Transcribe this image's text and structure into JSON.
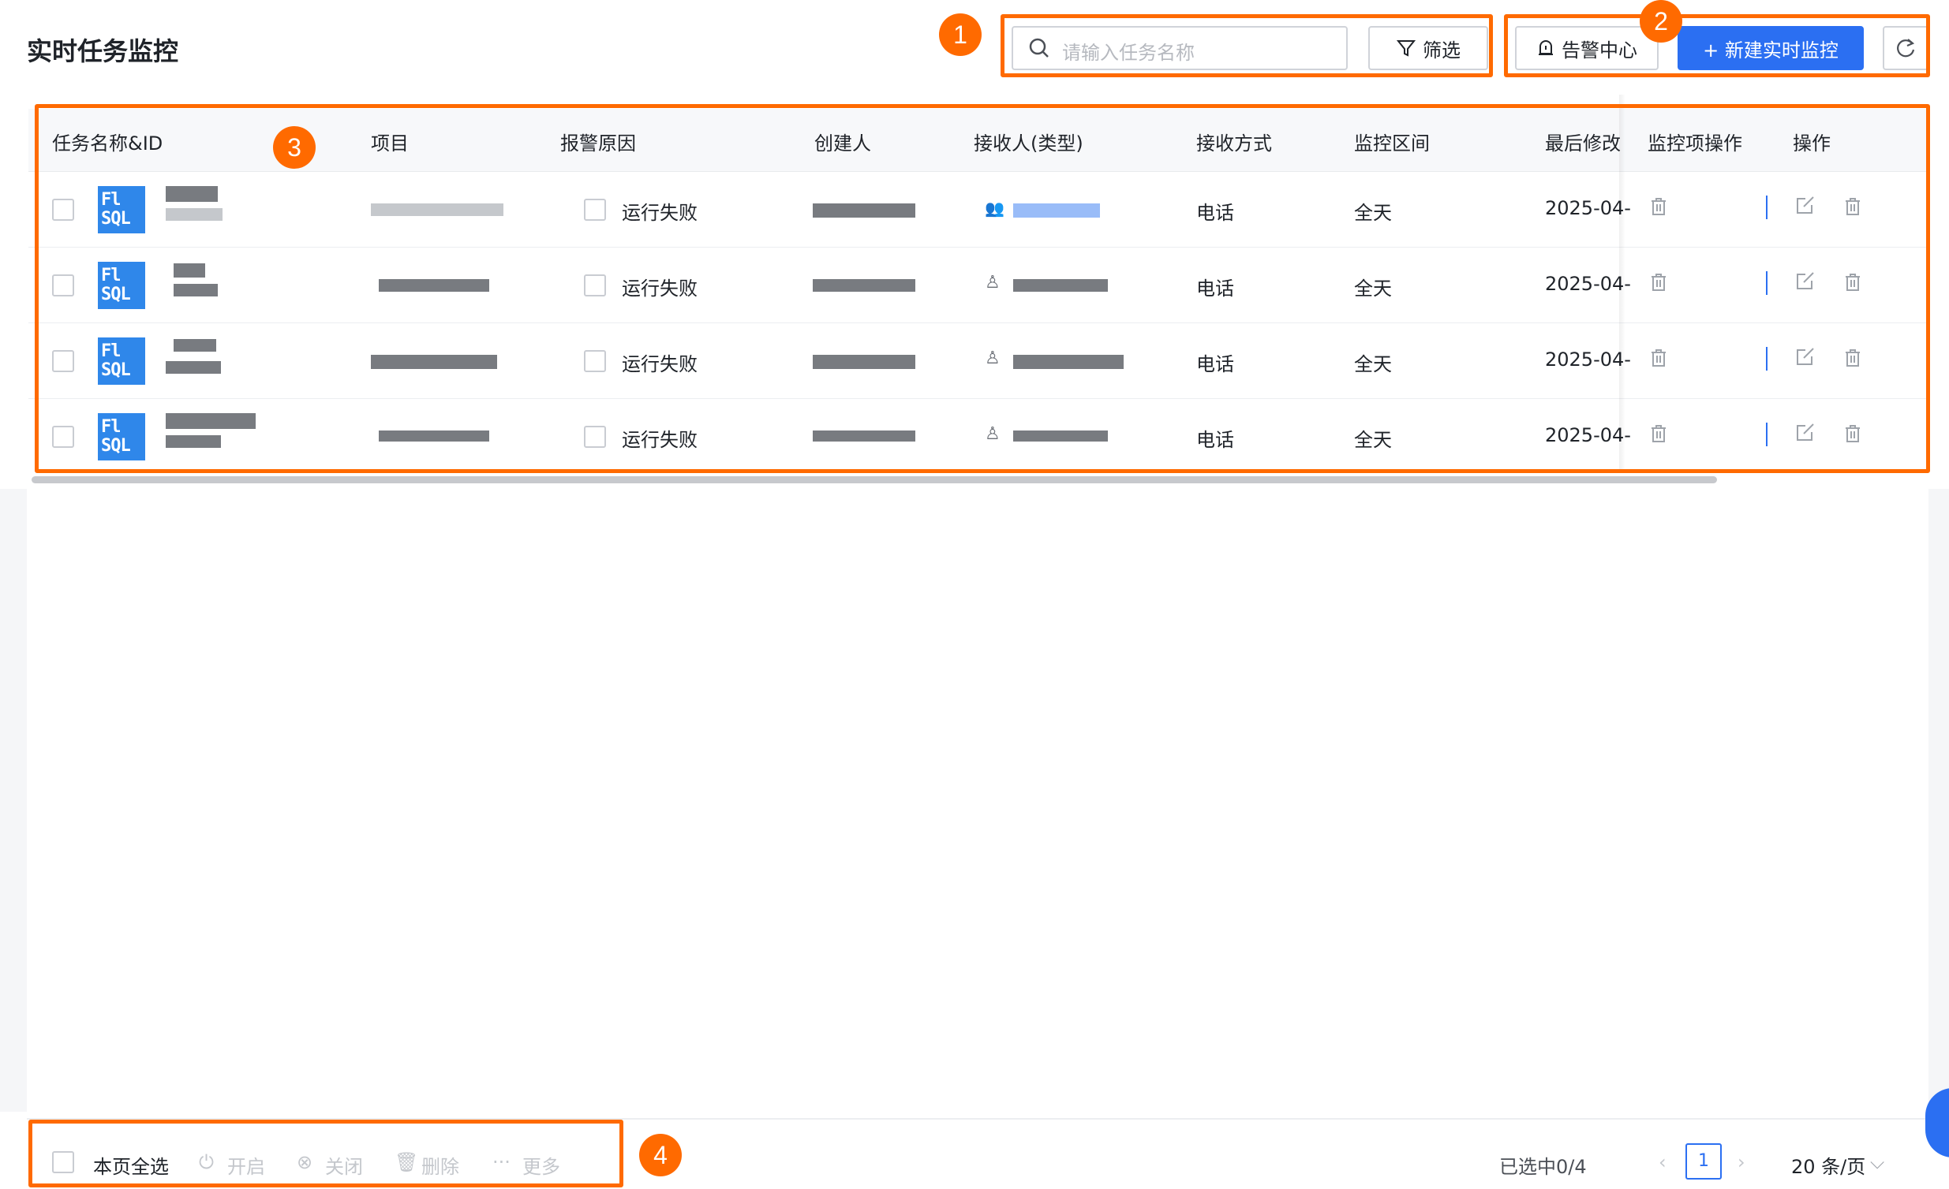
{
  "page": {
    "title": "实时任务监控"
  },
  "toolbar": {
    "search_placeholder": "请输入任务名称",
    "filter_label": "筛选",
    "alert_center_label": "告警中心",
    "new_monitor_label": "+ 新建实时监控"
  },
  "annotations": {
    "b1": "1",
    "b2": "2",
    "b3": "3",
    "b4": "4"
  },
  "table": {
    "headers": {
      "name": "任务名称&ID",
      "project": "项目",
      "reason": "报警原因",
      "creator": "创建人",
      "receiver": "接收人(类型)",
      "method": "接收方式",
      "range": "监控区间",
      "modified": "最后修改",
      "monitor_ops": "监控项操作",
      "ops": "操作"
    },
    "rows": [
      {
        "logo": "Fl SQL",
        "reason": "运行失败",
        "method": "电话",
        "range": "全天",
        "modified": "2025-04-"
      },
      {
        "logo": "Fl SQL",
        "reason": "运行失败",
        "method": "电话",
        "range": "全天",
        "modified": "2025-04-"
      },
      {
        "logo": "Fl SQL",
        "reason": "运行失败",
        "method": "电话",
        "range": "全天",
        "modified": "2025-04-"
      },
      {
        "logo": "Fl SQL",
        "reason": "运行失败",
        "method": "电话",
        "range": "全天",
        "modified": "2025-04-"
      }
    ]
  },
  "footer": {
    "select_all_label": "本页全选",
    "enable_label": "开启",
    "close_label": "关闭",
    "delete_label": "删除",
    "more_label": "更多",
    "selected_count": "已选中0/4",
    "current_page": "1",
    "page_size": "20 条/页"
  },
  "colors": {
    "accent": "#2b6ff2",
    "annotation": "#ff6a00"
  }
}
